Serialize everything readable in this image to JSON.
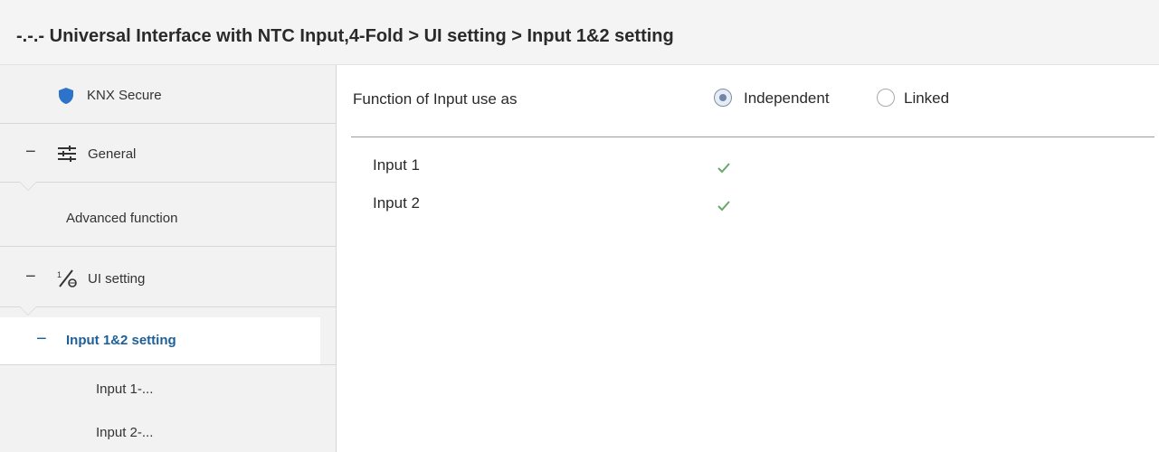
{
  "title_bar": {
    "breadcrumb": "-.-.- Universal Interface with NTC Input,4-Fold > UI setting > Input 1&2 setting"
  },
  "sidebar": {
    "items": [
      {
        "label": "KNX Secure",
        "icon": "shield-icon"
      },
      {
        "label": "General",
        "icon": "sliders-icon",
        "expanded": true
      },
      {
        "label": "Advanced function"
      },
      {
        "label": "UI setting",
        "icon": "ui-setting-icon",
        "expanded": true
      },
      {
        "label": "Input 1&2 setting",
        "selected": true,
        "expanded": true
      },
      {
        "label": "Input 1-..."
      },
      {
        "label": "Input 2-..."
      }
    ]
  },
  "main": {
    "function_label": "Function of Input use as",
    "function_options": [
      {
        "label": "Independent",
        "checked": true
      },
      {
        "label": "Linked",
        "checked": false
      }
    ],
    "inputs": [
      {
        "label": "Input 1",
        "checked": true
      },
      {
        "label": "Input 2",
        "checked": true
      }
    ]
  },
  "colors": {
    "accent": "#1d5f98",
    "shield": "#2d73c9",
    "check": "#6aa86a"
  }
}
